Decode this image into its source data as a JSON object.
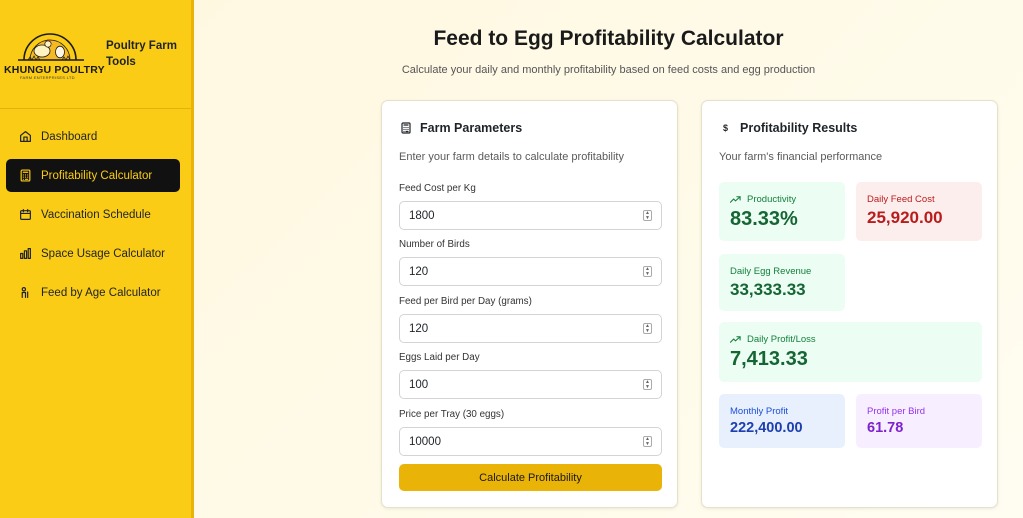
{
  "brand": {
    "logo_text": "KHUNGU POULTRY",
    "logo_sub": "FARM ENTERPRISES LTD",
    "title": "Poultry Farm Tools"
  },
  "nav": [
    {
      "label": "Dashboard",
      "icon": "home-icon",
      "active": false
    },
    {
      "label": "Profitability Calculator",
      "icon": "calculator-icon",
      "active": true
    },
    {
      "label": "Vaccination Schedule",
      "icon": "calendar-icon",
      "active": false
    },
    {
      "label": "Space Usage Calculator",
      "icon": "bar-chart-icon",
      "active": false
    },
    {
      "label": "Feed by Age Calculator",
      "icon": "person-icon",
      "active": false
    }
  ],
  "page": {
    "title": "Feed to Egg Profitability Calculator",
    "subtitle": "Calculate your daily and monthly profitability based on feed costs and egg production"
  },
  "params": {
    "title": "Farm Parameters",
    "description": "Enter your farm details to calculate profitability",
    "fields": [
      {
        "label": "Feed Cost per Kg",
        "value": "1800"
      },
      {
        "label": "Number of Birds",
        "value": "120"
      },
      {
        "label": "Feed per Bird per Day (grams)",
        "value": "120"
      },
      {
        "label": "Eggs Laid per Day",
        "value": "100"
      },
      {
        "label": "Price per Tray (30 eggs)",
        "value": "10000"
      }
    ],
    "button": "Calculate Profitability"
  },
  "results": {
    "title": "Profitability Results",
    "description": "Your farm's financial performance",
    "productivity": {
      "label": "Productivity",
      "value": "83.33%"
    },
    "daily_feed_cost": {
      "label": "Daily Feed Cost",
      "value": "25,920.00"
    },
    "daily_egg_revenue": {
      "label": "Daily Egg Revenue",
      "value": "33,333.33"
    },
    "daily_profit": {
      "label": "Daily Profit/Loss",
      "value": "7,413.33"
    },
    "monthly_profit": {
      "label": "Monthly Profit",
      "value": "222,400.00"
    },
    "profit_per_bird": {
      "label": "Profit per Bird",
      "value": "61.78"
    }
  },
  "colors": {
    "sidebar": "#facc15",
    "active_nav": "#111111",
    "button": "#eab308",
    "green": "#15803d",
    "red": "#b91c1c",
    "blue": "#1d4ed8",
    "purple": "#9333ea"
  }
}
